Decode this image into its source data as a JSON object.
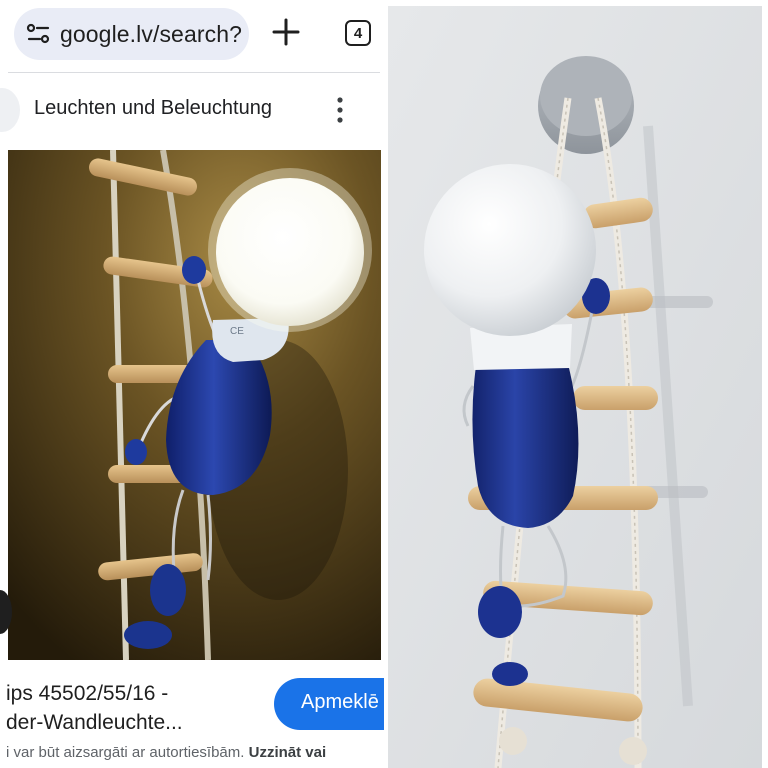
{
  "browser": {
    "url": "google.lv/search?",
    "tab_count": "4",
    "icons": [
      "site-info-icon",
      "plus-icon",
      "tab-switcher-icon",
      "more-vert-icon"
    ]
  },
  "result": {
    "title": "Leuchten und Beleuchtung",
    "caption_line1": "ips 45502/55/16 -",
    "caption_line2": "der-Wandleuchte...",
    "visit_label": "Apmeklē",
    "copyright_text": "i var būt aizsargāti ar autortiesībām.",
    "copyright_link": "Uzzināt vai"
  },
  "colors": {
    "accent": "#1a73e8",
    "pill": "#e9ecf6",
    "lamp_body": "#1e3a8a"
  }
}
